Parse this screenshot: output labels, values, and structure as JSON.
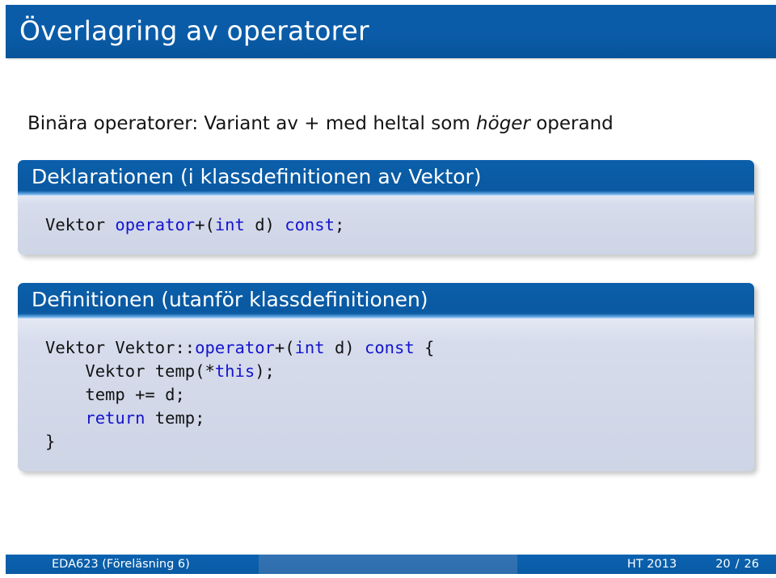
{
  "slide": {
    "title": "Överlagring av operatorer",
    "subtitle": {
      "before": "Binära operatorer: Variant av + med heltal som ",
      "emphasis": "höger",
      "after": " operand"
    }
  },
  "blocks": [
    {
      "title": "Deklarationen (i klassdefinitionen av Vektor)",
      "code_lines": [
        [
          {
            "t": "Vektor ",
            "kw": false
          },
          {
            "t": "operator",
            "kw": true
          },
          {
            "t": "+(",
            "kw": false
          },
          {
            "t": "int",
            "kw": true
          },
          {
            "t": " d) ",
            "kw": false
          },
          {
            "t": "const",
            "kw": true
          },
          {
            "t": ";",
            "kw": false
          }
        ]
      ]
    },
    {
      "title": "Definitionen (utanför klassdefinitionen)",
      "code_lines": [
        [
          {
            "t": "Vektor Vektor::",
            "kw": false
          },
          {
            "t": "operator",
            "kw": true
          },
          {
            "t": "+(",
            "kw": false
          },
          {
            "t": "int",
            "kw": true
          },
          {
            "t": " d) ",
            "kw": false
          },
          {
            "t": "const",
            "kw": true
          },
          {
            "t": " {",
            "kw": false
          }
        ],
        [
          {
            "t": "    Vektor temp(*",
            "kw": false
          },
          {
            "t": "this",
            "kw": true
          },
          {
            "t": ");",
            "kw": false
          }
        ],
        [
          {
            "t": "    temp += d;",
            "kw": false
          }
        ],
        [
          {
            "t": "    ",
            "kw": false
          },
          {
            "t": "return",
            "kw": true
          },
          {
            "t": " temp;",
            "kw": false
          }
        ],
        [
          {
            "t": "}",
            "kw": false
          }
        ]
      ]
    }
  ],
  "footer": {
    "course": "EDA623  (Föreläsning 6)",
    "term": "HT 2013",
    "page_current": "20",
    "page_separator": "/",
    "page_total": "26"
  },
  "colors": {
    "brand_blue": "#0a5aa3",
    "block_body": "#d2d8e8",
    "keyword_blue": "#1414cc",
    "footer_mid": "#3273b4"
  }
}
